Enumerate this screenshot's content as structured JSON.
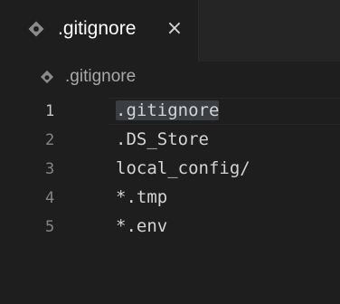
{
  "tab": {
    "icon": "gitignore-file-icon",
    "label": ".gitignore",
    "close_label": "×"
  },
  "breadcrumb": {
    "icon": "gitignore-file-icon",
    "label": ".gitignore"
  },
  "editor": {
    "lines": [
      {
        "number": "1",
        "prefix": "",
        "highlight": ".gitignore",
        "text": ""
      },
      {
        "number": "2",
        "prefix": ".DS_Store",
        "highlight": "",
        "text": ""
      },
      {
        "number": "3",
        "prefix": "local_config/",
        "highlight": "",
        "text": ""
      },
      {
        "number": "4",
        "prefix": "*.tmp",
        "highlight": "",
        "text": ""
      },
      {
        "number": "5",
        "prefix": "*.env",
        "highlight": "",
        "text": ""
      }
    ]
  },
  "colors": {
    "background": "#1e1e1e",
    "tabbar": "#252526",
    "text": "#d4d4d4",
    "line_number": "#858585",
    "selection_highlight": "#3a3d41"
  }
}
